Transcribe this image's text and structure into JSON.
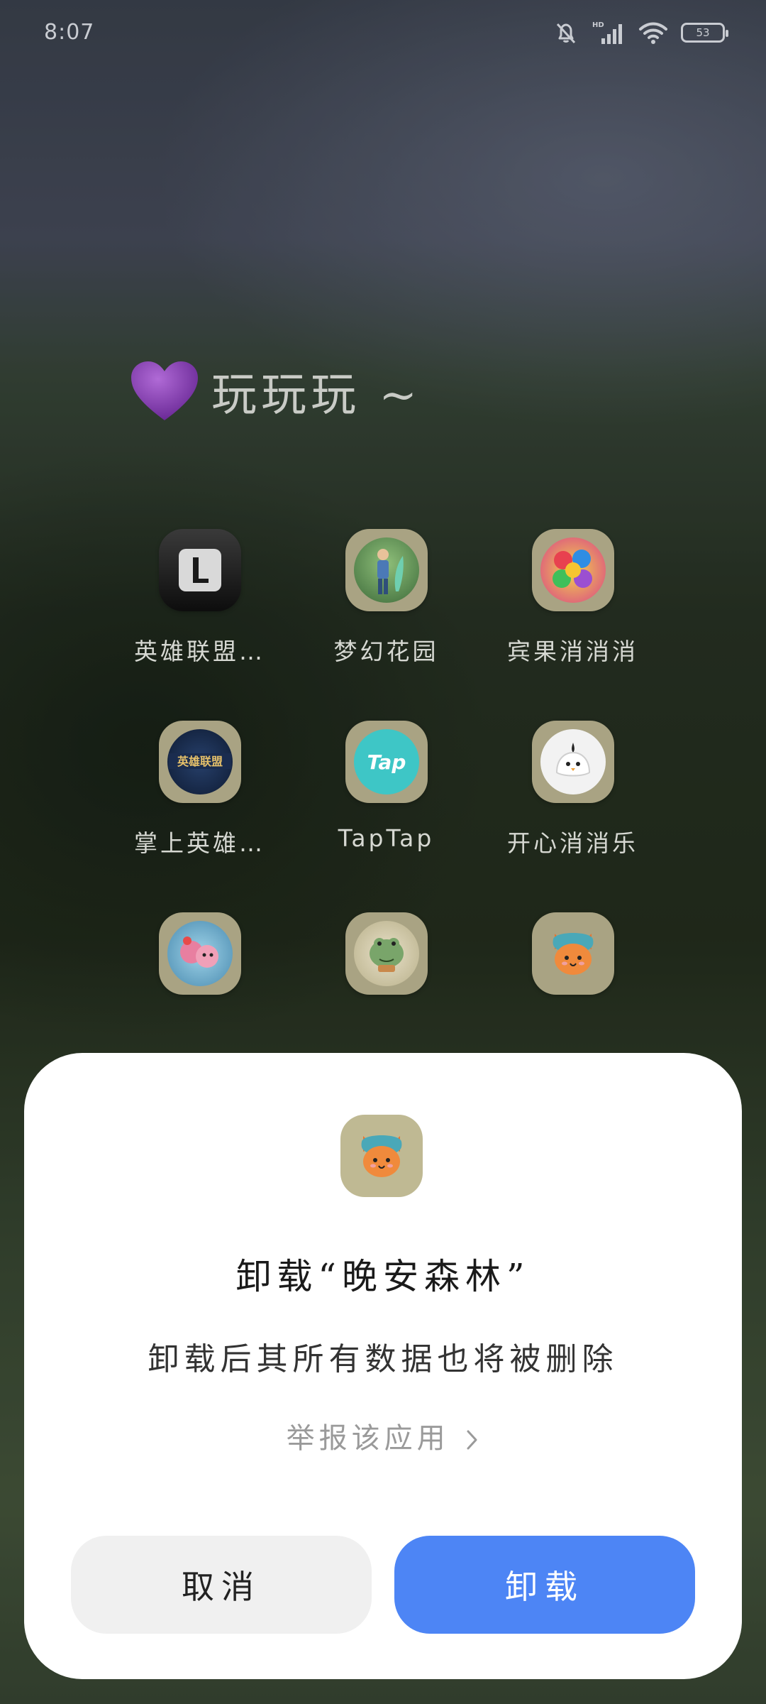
{
  "status_bar": {
    "time": "8:07",
    "battery": "53",
    "icons": [
      "bell-off-icon",
      "hd-signal-icon",
      "wifi-icon",
      "battery-icon"
    ]
  },
  "folder": {
    "emoji_icon": "purple-heart-icon",
    "title": "玩玩玩 ~",
    "apps": [
      {
        "label": "英雄联盟…",
        "icon": "league-of-legends-icon"
      },
      {
        "label": "梦幻花园",
        "icon": "gardenscapes-icon"
      },
      {
        "label": "宾果消消消",
        "icon": "bingo-match-icon"
      },
      {
        "label": "掌上英雄…",
        "icon": "lol-companion-icon"
      },
      {
        "label": "TapTap",
        "icon": "taptap-icon"
      },
      {
        "label": "开心消消乐",
        "icon": "happy-match-icon"
      },
      {
        "label": "",
        "icon": "pink-bear-game-icon"
      },
      {
        "label": "",
        "icon": "frog-travel-icon"
      },
      {
        "label": "",
        "icon": "fox-forest-icon"
      }
    ]
  },
  "dialog": {
    "app_icon": "fox-forest-icon",
    "title": "卸载“晚安森林”",
    "message": "卸载后其所有数据也将被删除",
    "report_link": "举报该应用",
    "cancel_label": "取消",
    "uninstall_label": "卸载",
    "accent_color": "#4d85f5"
  }
}
